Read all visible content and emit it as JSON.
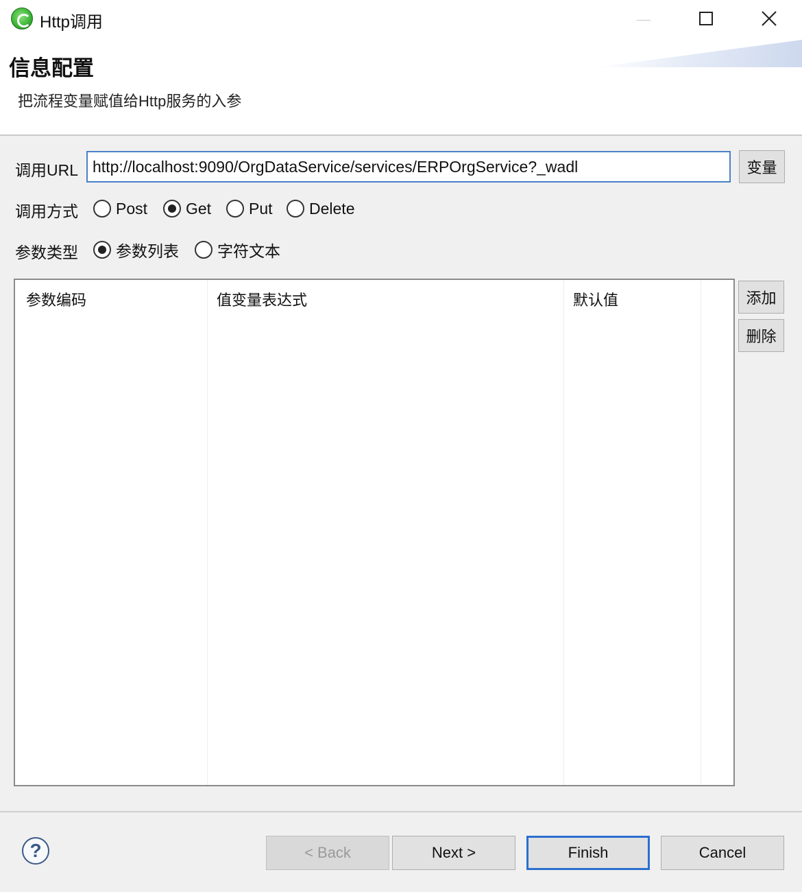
{
  "window": {
    "title": "Http调用",
    "icon": "app-logo-icon"
  },
  "header": {
    "title": "信息配置",
    "description": "把流程变量赋值给Http服务的入参"
  },
  "url": {
    "label": "调用URL",
    "value": "http://localhost:9090/OrgDataService/services/ERPOrgService?_wadl",
    "var_button": "变量"
  },
  "method": {
    "label": "调用方式",
    "options": [
      {
        "label": "Post",
        "selected": false
      },
      {
        "label": "Get",
        "selected": true
      },
      {
        "label": "Put",
        "selected": false
      },
      {
        "label": "Delete",
        "selected": false
      }
    ]
  },
  "param_type": {
    "label": "参数类型",
    "options": [
      {
        "label": "参数列表",
        "selected": true
      },
      {
        "label": "字符文本",
        "selected": false
      }
    ]
  },
  "table": {
    "columns": [
      "参数编码",
      "值变量表达式",
      "默认值"
    ],
    "rows": []
  },
  "side_buttons": {
    "add": "添加",
    "delete": "删除"
  },
  "footer": {
    "back": "< Back",
    "next": "Next >",
    "finish": "Finish",
    "cancel": "Cancel",
    "help": "?"
  }
}
